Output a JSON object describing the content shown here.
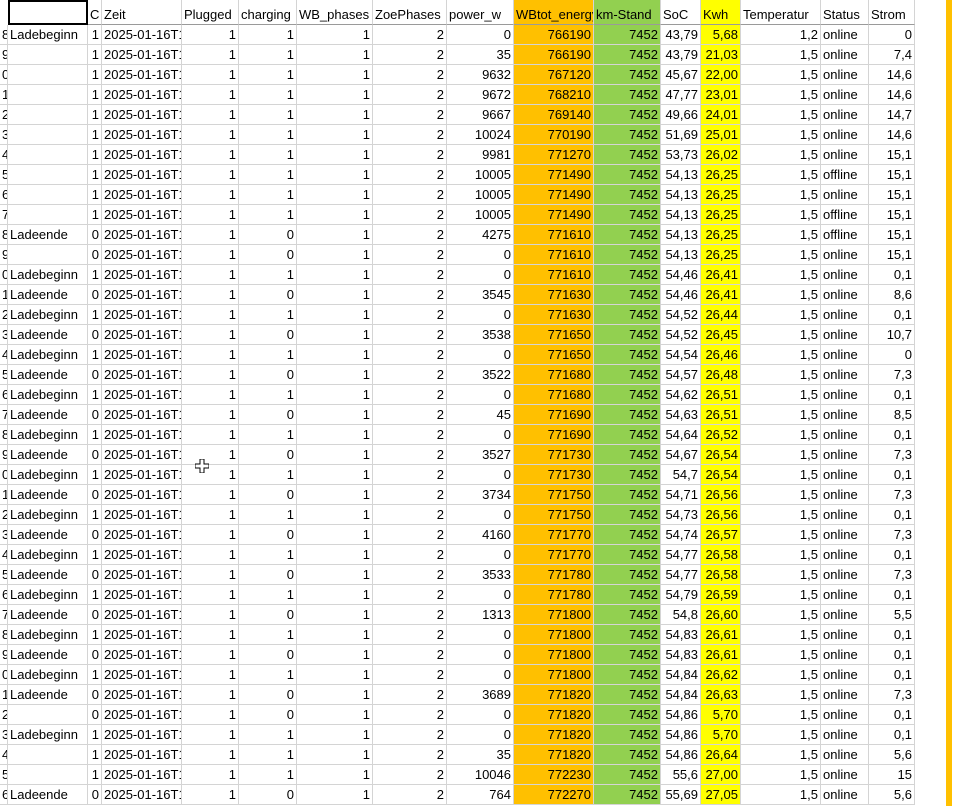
{
  "colors": {
    "wbtot": "#ffc000",
    "km": "#92d050",
    "kwh": "#ffff00",
    "edge": "#ffc000"
  },
  "icons": {
    "cursor": "cell-select-plus-cursor-icon"
  },
  "headers": [
    "",
    "C",
    "Zeit",
    "Plugged",
    "charging",
    "WB_phases",
    "ZoePhases",
    "power_w",
    "WBtot_energy",
    "km-Stand",
    "SoC",
    "Kwh",
    "Temperatur",
    "Status",
    "Strom"
  ],
  "rows": [
    [
      "8",
      "Ladebeginn",
      "1",
      "2025-01-16T1",
      "1",
      "1",
      "1",
      "2",
      "0",
      "766190",
      "7452",
      "43,79",
      "5,68",
      "1,2",
      "online",
      "0"
    ],
    [
      "9",
      "",
      "1",
      "2025-01-16T1",
      "1",
      "1",
      "1",
      "2",
      "35",
      "766190",
      "7452",
      "43,79",
      "21,03",
      "1,5",
      "online",
      "7,4"
    ],
    [
      "0",
      "",
      "1",
      "2025-01-16T1",
      "1",
      "1",
      "1",
      "2",
      "9632",
      "767120",
      "7452",
      "45,67",
      "22,00",
      "1,5",
      "online",
      "14,6"
    ],
    [
      "1",
      "",
      "1",
      "2025-01-16T1",
      "1",
      "1",
      "1",
      "2",
      "9672",
      "768210",
      "7452",
      "47,77",
      "23,01",
      "1,5",
      "online",
      "14,6"
    ],
    [
      "2",
      "",
      "1",
      "2025-01-16T1",
      "1",
      "1",
      "1",
      "2",
      "9667",
      "769140",
      "7452",
      "49,66",
      "24,01",
      "1,5",
      "online",
      "14,7"
    ],
    [
      "3",
      "",
      "1",
      "2025-01-16T1",
      "1",
      "1",
      "1",
      "2",
      "10024",
      "770190",
      "7452",
      "51,69",
      "25,01",
      "1,5",
      "online",
      "14,6"
    ],
    [
      "4",
      "",
      "1",
      "2025-01-16T1",
      "1",
      "1",
      "1",
      "2",
      "9981",
      "771270",
      "7452",
      "53,73",
      "26,02",
      "1,5",
      "online",
      "15,1"
    ],
    [
      "5",
      "",
      "1",
      "2025-01-16T1",
      "1",
      "1",
      "1",
      "2",
      "10005",
      "771490",
      "7452",
      "54,13",
      "26,25",
      "1,5",
      "offline",
      "15,1"
    ],
    [
      "6",
      "",
      "1",
      "2025-01-16T1",
      "1",
      "1",
      "1",
      "2",
      "10005",
      "771490",
      "7452",
      "54,13",
      "26,25",
      "1,5",
      "online",
      "15,1"
    ],
    [
      "7",
      "",
      "1",
      "2025-01-16T1",
      "1",
      "1",
      "1",
      "2",
      "10005",
      "771490",
      "7452",
      "54,13",
      "26,25",
      "1,5",
      "offline",
      "15,1"
    ],
    [
      "8",
      "Ladeende",
      "0",
      "2025-01-16T1",
      "1",
      "0",
      "1",
      "2",
      "4275",
      "771610",
      "7452",
      "54,13",
      "26,25",
      "1,5",
      "offline",
      "15,1"
    ],
    [
      "9",
      "",
      "0",
      "2025-01-16T1",
      "1",
      "0",
      "1",
      "2",
      "0",
      "771610",
      "7452",
      "54,13",
      "26,25",
      "1,5",
      "online",
      "15,1"
    ],
    [
      "0",
      "Ladebeginn",
      "1",
      "2025-01-16T1",
      "1",
      "1",
      "1",
      "2",
      "0",
      "771610",
      "7452",
      "54,46",
      "26,41",
      "1,5",
      "online",
      "0,1"
    ],
    [
      "1",
      "Ladeende",
      "0",
      "2025-01-16T1",
      "1",
      "0",
      "1",
      "2",
      "3545",
      "771630",
      "7452",
      "54,46",
      "26,41",
      "1,5",
      "online",
      "8,6"
    ],
    [
      "2",
      "Ladebeginn",
      "1",
      "2025-01-16T1",
      "1",
      "1",
      "1",
      "2",
      "0",
      "771630",
      "7452",
      "54,52",
      "26,44",
      "1,5",
      "online",
      "0,1"
    ],
    [
      "3",
      "Ladeende",
      "0",
      "2025-01-16T1",
      "1",
      "0",
      "1",
      "2",
      "3538",
      "771650",
      "7452",
      "54,52",
      "26,45",
      "1,5",
      "online",
      "10,7"
    ],
    [
      "4",
      "Ladebeginn",
      "1",
      "2025-01-16T1",
      "1",
      "1",
      "1",
      "2",
      "0",
      "771650",
      "7452",
      "54,54",
      "26,46",
      "1,5",
      "online",
      "0"
    ],
    [
      "5",
      "Ladeende",
      "0",
      "2025-01-16T1",
      "1",
      "0",
      "1",
      "2",
      "3522",
      "771680",
      "7452",
      "54,57",
      "26,48",
      "1,5",
      "online",
      "7,3"
    ],
    [
      "6",
      "Ladebeginn",
      "1",
      "2025-01-16T1",
      "1",
      "1",
      "1",
      "2",
      "0",
      "771680",
      "7452",
      "54,62",
      "26,51",
      "1,5",
      "online",
      "0,1"
    ],
    [
      "7",
      "Ladeende",
      "0",
      "2025-01-16T1",
      "1",
      "0",
      "1",
      "2",
      "45",
      "771690",
      "7452",
      "54,63",
      "26,51",
      "1,5",
      "online",
      "8,5"
    ],
    [
      "8",
      "Ladebeginn",
      "1",
      "2025-01-16T1",
      "1",
      "1",
      "1",
      "2",
      "0",
      "771690",
      "7452",
      "54,64",
      "26,52",
      "1,5",
      "online",
      "0,1"
    ],
    [
      "9",
      "Ladeende",
      "0",
      "2025-01-16T1",
      "1",
      "0",
      "1",
      "2",
      "3527",
      "771730",
      "7452",
      "54,67",
      "26,54",
      "1,5",
      "online",
      "7,3"
    ],
    [
      "0",
      "Ladebeginn",
      "1",
      "2025-01-16T1",
      "1",
      "1",
      "1",
      "2",
      "0",
      "771730",
      "7452",
      "54,7",
      "26,54",
      "1,5",
      "online",
      "0,1"
    ],
    [
      "1",
      "Ladeende",
      "0",
      "2025-01-16T1",
      "1",
      "0",
      "1",
      "2",
      "3734",
      "771750",
      "7452",
      "54,71",
      "26,56",
      "1,5",
      "online",
      "7,3"
    ],
    [
      "2",
      "Ladebeginn",
      "1",
      "2025-01-16T1",
      "1",
      "1",
      "1",
      "2",
      "0",
      "771750",
      "7452",
      "54,73",
      "26,56",
      "1,5",
      "online",
      "0,1"
    ],
    [
      "3",
      "Ladeende",
      "0",
      "2025-01-16T1",
      "1",
      "0",
      "1",
      "2",
      "4160",
      "771770",
      "7452",
      "54,74",
      "26,57",
      "1,5",
      "online",
      "7,3"
    ],
    [
      "4",
      "Ladebeginn",
      "1",
      "2025-01-16T1",
      "1",
      "1",
      "1",
      "2",
      "0",
      "771770",
      "7452",
      "54,77",
      "26,58",
      "1,5",
      "online",
      "0,1"
    ],
    [
      "5",
      "Ladeende",
      "0",
      "2025-01-16T1",
      "1",
      "0",
      "1",
      "2",
      "3533",
      "771780",
      "7452",
      "54,77",
      "26,58",
      "1,5",
      "online",
      "7,3"
    ],
    [
      "6",
      "Ladebeginn",
      "1",
      "2025-01-16T1",
      "1",
      "1",
      "1",
      "2",
      "0",
      "771780",
      "7452",
      "54,79",
      "26,59",
      "1,5",
      "online",
      "0,1"
    ],
    [
      "7",
      "Ladeende",
      "0",
      "2025-01-16T1",
      "1",
      "0",
      "1",
      "2",
      "1313",
      "771800",
      "7452",
      "54,8",
      "26,60",
      "1,5",
      "online",
      "5,5"
    ],
    [
      "8",
      "Ladebeginn",
      "1",
      "2025-01-16T1",
      "1",
      "1",
      "1",
      "2",
      "0",
      "771800",
      "7452",
      "54,83",
      "26,61",
      "1,5",
      "online",
      "0,1"
    ],
    [
      "9",
      "Ladeende",
      "0",
      "2025-01-16T1",
      "1",
      "0",
      "1",
      "2",
      "0",
      "771800",
      "7452",
      "54,83",
      "26,61",
      "1,5",
      "online",
      "0,1"
    ],
    [
      "0",
      "Ladebeginn",
      "1",
      "2025-01-16T1",
      "1",
      "1",
      "1",
      "2",
      "0",
      "771800",
      "7452",
      "54,84",
      "26,62",
      "1,5",
      "online",
      "0,1"
    ],
    [
      "1",
      "Ladeende",
      "0",
      "2025-01-16T1",
      "1",
      "0",
      "1",
      "2",
      "3689",
      "771820",
      "7452",
      "54,84",
      "26,63",
      "1,5",
      "online",
      "7,3"
    ],
    [
      "2",
      "",
      "0",
      "2025-01-16T1",
      "1",
      "0",
      "1",
      "2",
      "0",
      "771820",
      "7452",
      "54,86",
      "5,70",
      "1,5",
      "online",
      "0,1"
    ],
    [
      "3",
      "Ladebeginn",
      "1",
      "2025-01-16T1",
      "1",
      "1",
      "1",
      "2",
      "0",
      "771820",
      "7452",
      "54,86",
      "5,70",
      "1,5",
      "online",
      "0,1"
    ],
    [
      "4",
      "",
      "1",
      "2025-01-16T1",
      "1",
      "1",
      "1",
      "2",
      "35",
      "771820",
      "7452",
      "54,86",
      "26,64",
      "1,5",
      "online",
      "5,6"
    ],
    [
      "5",
      "",
      "1",
      "2025-01-16T1",
      "1",
      "1",
      "1",
      "2",
      "10046",
      "772230",
      "7452",
      "55,6",
      "27,00",
      "1,5",
      "online",
      "15"
    ],
    [
      "6",
      "Ladeende",
      "0",
      "2025-01-16T1",
      "1",
      "0",
      "1",
      "2",
      "764",
      "772270",
      "7452",
      "55,69",
      "27,05",
      "1,5",
      "online",
      "5,6"
    ]
  ]
}
